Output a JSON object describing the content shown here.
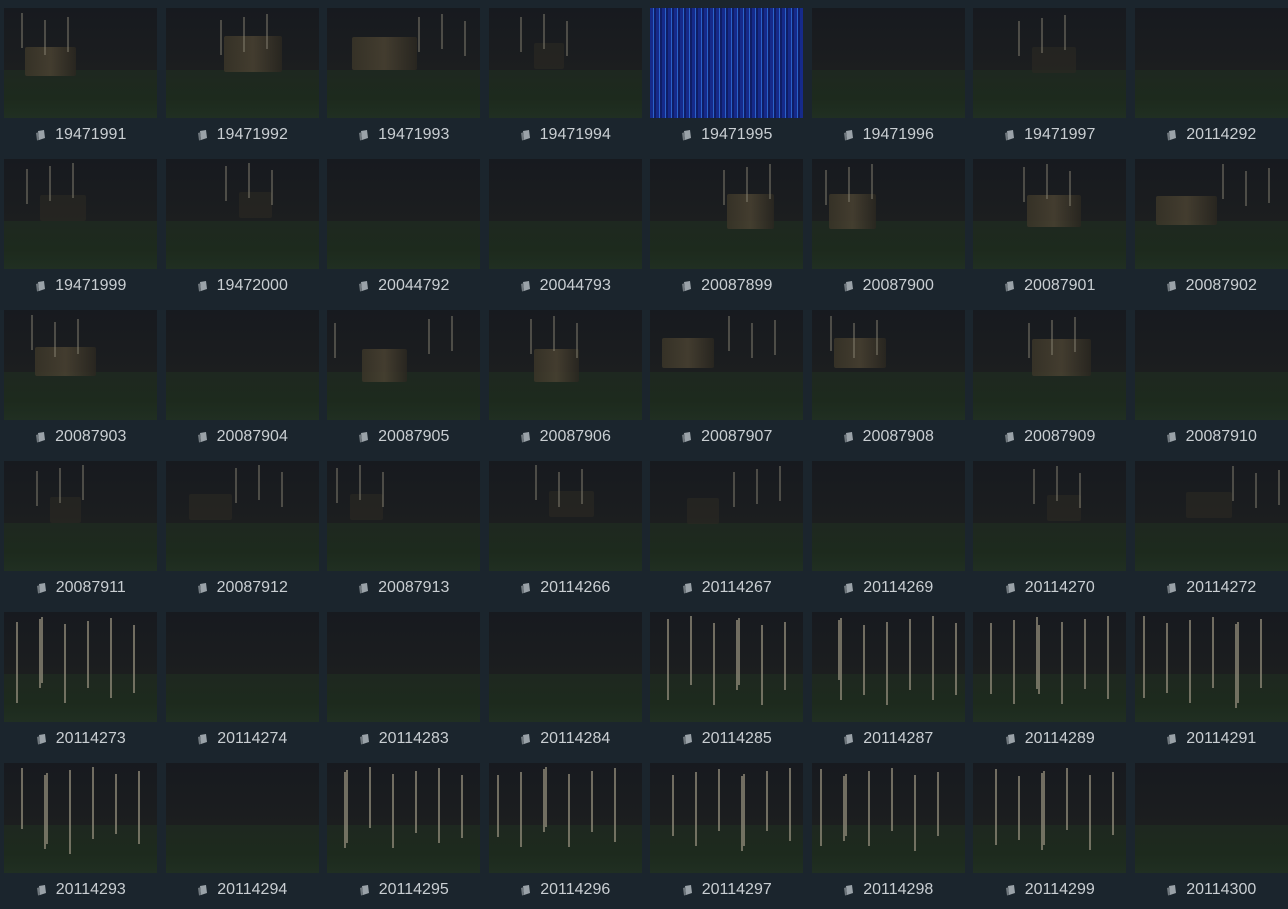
{
  "gallery": {
    "item_icon": "image-stack-icon",
    "items": [
      {
        "label": "19471991",
        "tone": "room-lit"
      },
      {
        "label": "19471992",
        "tone": "room-lit"
      },
      {
        "label": "19471993",
        "tone": "room-lit"
      },
      {
        "label": "19471994",
        "tone": "room-dim"
      },
      {
        "label": "19471995",
        "tone": "blue-stripes"
      },
      {
        "label": "19471996",
        "tone": "dark"
      },
      {
        "label": "19471997",
        "tone": "room-dim"
      },
      {
        "label": "20114292",
        "tone": "dark"
      },
      {
        "label": "19471999",
        "tone": "room-dim"
      },
      {
        "label": "19472000",
        "tone": "room-dim"
      },
      {
        "label": "20044792",
        "tone": "dark"
      },
      {
        "label": "20044793",
        "tone": "dark"
      },
      {
        "label": "20087899",
        "tone": "room-lit"
      },
      {
        "label": "20087900",
        "tone": "room-lit"
      },
      {
        "label": "20087901",
        "tone": "room-lit"
      },
      {
        "label": "20087902",
        "tone": "room-lit"
      },
      {
        "label": "20087903",
        "tone": "room-lit"
      },
      {
        "label": "20087904",
        "tone": "dark"
      },
      {
        "label": "20087905",
        "tone": "room-lit"
      },
      {
        "label": "20087906",
        "tone": "room-lit"
      },
      {
        "label": "20087907",
        "tone": "room-lit"
      },
      {
        "label": "20087908",
        "tone": "room-lit"
      },
      {
        "label": "20087909",
        "tone": "room-lit"
      },
      {
        "label": "20087910",
        "tone": "dark"
      },
      {
        "label": "20087911",
        "tone": "room-dim"
      },
      {
        "label": "20087912",
        "tone": "room-dim"
      },
      {
        "label": "20087913",
        "tone": "room-dim"
      },
      {
        "label": "20114266",
        "tone": "room-dim"
      },
      {
        "label": "20114267",
        "tone": "room-dim"
      },
      {
        "label": "20114269",
        "tone": "dark"
      },
      {
        "label": "20114270",
        "tone": "room-dim"
      },
      {
        "label": "20114272",
        "tone": "room-dim"
      },
      {
        "label": "20114273",
        "tone": "bars"
      },
      {
        "label": "20114274",
        "tone": "dark"
      },
      {
        "label": "20114283",
        "tone": "dark"
      },
      {
        "label": "20114284",
        "tone": "dark"
      },
      {
        "label": "20114285",
        "tone": "bars"
      },
      {
        "label": "20114287",
        "tone": "bars"
      },
      {
        "label": "20114289",
        "tone": "bars"
      },
      {
        "label": "20114291",
        "tone": "bars"
      },
      {
        "label": "20114293",
        "tone": "bars"
      },
      {
        "label": "20114294",
        "tone": "dark"
      },
      {
        "label": "20114295",
        "tone": "bars"
      },
      {
        "label": "20114296",
        "tone": "bars"
      },
      {
        "label": "20114297",
        "tone": "bars"
      },
      {
        "label": "20114298",
        "tone": "bars"
      },
      {
        "label": "20114299",
        "tone": "bars"
      },
      {
        "label": "20114300",
        "tone": "dark"
      }
    ]
  },
  "colors": {
    "background": "#1b252d",
    "caption_text": "#c9ced2",
    "thumb_dark": "#14181d",
    "blue_frame": "#162a8a"
  }
}
